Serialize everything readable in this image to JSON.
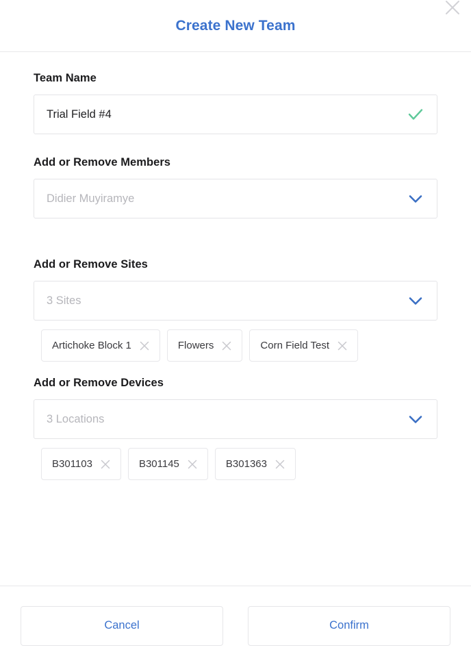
{
  "dialog": {
    "title": "Create New Team",
    "close_icon": "close-icon"
  },
  "team_name": {
    "label": "Team Name",
    "value": "Trial Field #4",
    "placeholder": "Team Name",
    "valid_icon": "check-icon"
  },
  "members": {
    "label": "Add or Remove Members",
    "value": "",
    "placeholder": "Didier Muyiramye",
    "dropdown_icon": "chevron-down-icon"
  },
  "sites": {
    "label": "Add or Remove Sites",
    "value": "",
    "placeholder": "3 Sites",
    "dropdown_icon": "chevron-down-icon",
    "chips": [
      {
        "label": "Artichoke Block 1",
        "remove_icon": "close-icon"
      },
      {
        "label": "Flowers",
        "remove_icon": "close-icon"
      },
      {
        "label": "Corn Field Test",
        "remove_icon": "close-icon"
      }
    ]
  },
  "devices": {
    "label": "Add or Remove Devices",
    "value": "",
    "placeholder": "3 Locations",
    "dropdown_icon": "chevron-down-icon",
    "chips": [
      {
        "label": "B301103",
        "remove_icon": "close-icon"
      },
      {
        "label": "B301145",
        "remove_icon": "close-icon"
      },
      {
        "label": "B301363",
        "remove_icon": "close-icon"
      }
    ]
  },
  "footer": {
    "cancel_label": "Cancel",
    "confirm_label": "Confirm"
  },
  "colors": {
    "accent_blue": "#3b72cd",
    "success_green": "#5fc99a",
    "border_gray": "#e4e4e7",
    "placeholder_gray": "#b6b6bb",
    "icon_gray": "#cfcfd3"
  }
}
